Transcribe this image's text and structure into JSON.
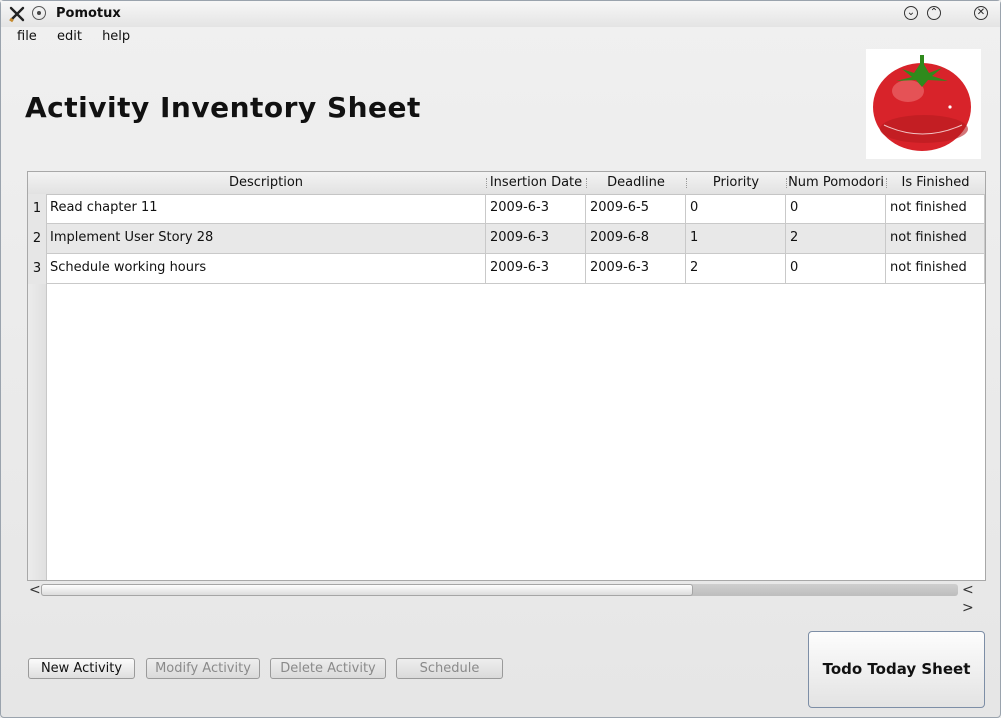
{
  "window": {
    "title": "Pomotux"
  },
  "menu": {
    "items": [
      "file",
      "edit",
      "help"
    ]
  },
  "page": {
    "title": "Activity Inventory Sheet"
  },
  "icons": {
    "app": "tools-icon",
    "pin": "pin-icon",
    "minimize": "chevron-down-icon",
    "maximize": "chevron-up-icon",
    "close": "close-icon",
    "logo": "tomato-timer-icon"
  },
  "table": {
    "columns": [
      "Description",
      "Insertion Date",
      "Deadline",
      "Priority",
      "Num Pomodori",
      "Is Finished"
    ],
    "rows": [
      {
        "num": "1",
        "cells": [
          "Read chapter 11",
          "2009-6-3",
          "2009-6-5",
          "0",
          "0",
          "not finished"
        ]
      },
      {
        "num": "2",
        "cells": [
          "Implement User Story 28",
          "2009-6-3",
          "2009-6-8",
          "1",
          "2",
          "not finished"
        ]
      },
      {
        "num": "3",
        "cells": [
          "Schedule working hours",
          "2009-6-3",
          "2009-6-3",
          "2",
          "0",
          "not finished"
        ]
      }
    ]
  },
  "scroll": {
    "left_arrow": "<",
    "right_arrows": "< >"
  },
  "buttons": {
    "new_activity": "New Activity",
    "modify_activity": "Modify Activity",
    "delete_activity": "Delete Activity",
    "schedule": "Schedule",
    "todo_today": "Todo Today Sheet"
  },
  "colors": {
    "tomato": "#d8232a",
    "leaf": "#2f8a1c",
    "window_border": "#9aa3ad"
  }
}
